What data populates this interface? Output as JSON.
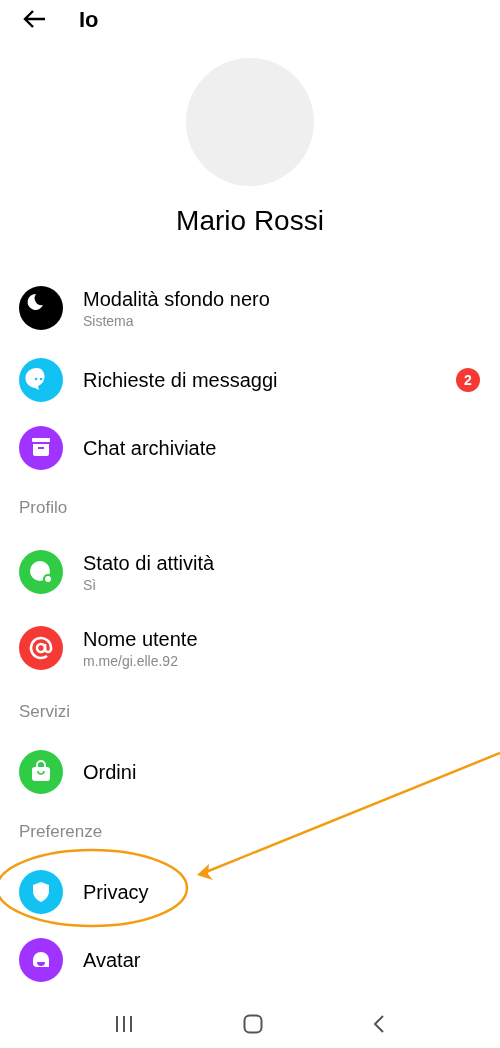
{
  "header": {
    "title": "Io"
  },
  "profile": {
    "name": "Mario Rossi"
  },
  "sections": [
    {
      "items": [
        {
          "title": "Modalità sfondo nero",
          "subtitle": "Sistema",
          "color": "#000000",
          "highlighted": false
        },
        {
          "title": "Richieste di messaggi",
          "badge": "2",
          "color": "#12c2f2",
          "highlighted": false
        },
        {
          "title": "Chat archiviate",
          "color": "#a033ff",
          "highlighted": false
        }
      ]
    },
    {
      "title": "Profilo",
      "items": [
        {
          "title": "Stato di attività",
          "subtitle": "Sì",
          "color": "#31cc46",
          "highlighted": false
        },
        {
          "title": "Nome utente",
          "subtitle": "m.me/gi.elle.92",
          "color": "#f53a36",
          "highlighted": false
        }
      ]
    },
    {
      "title": "Servizi",
      "items": [
        {
          "title": "Ordini",
          "color": "#31cc46",
          "highlighted": false
        }
      ]
    },
    {
      "title": "Preferenze",
      "items": [
        {
          "title": "Privacy",
          "color": "#12c2f2",
          "highlighted": true
        },
        {
          "title": "Avatar",
          "color": "#a033ff",
          "highlighted": false
        }
      ]
    }
  ]
}
